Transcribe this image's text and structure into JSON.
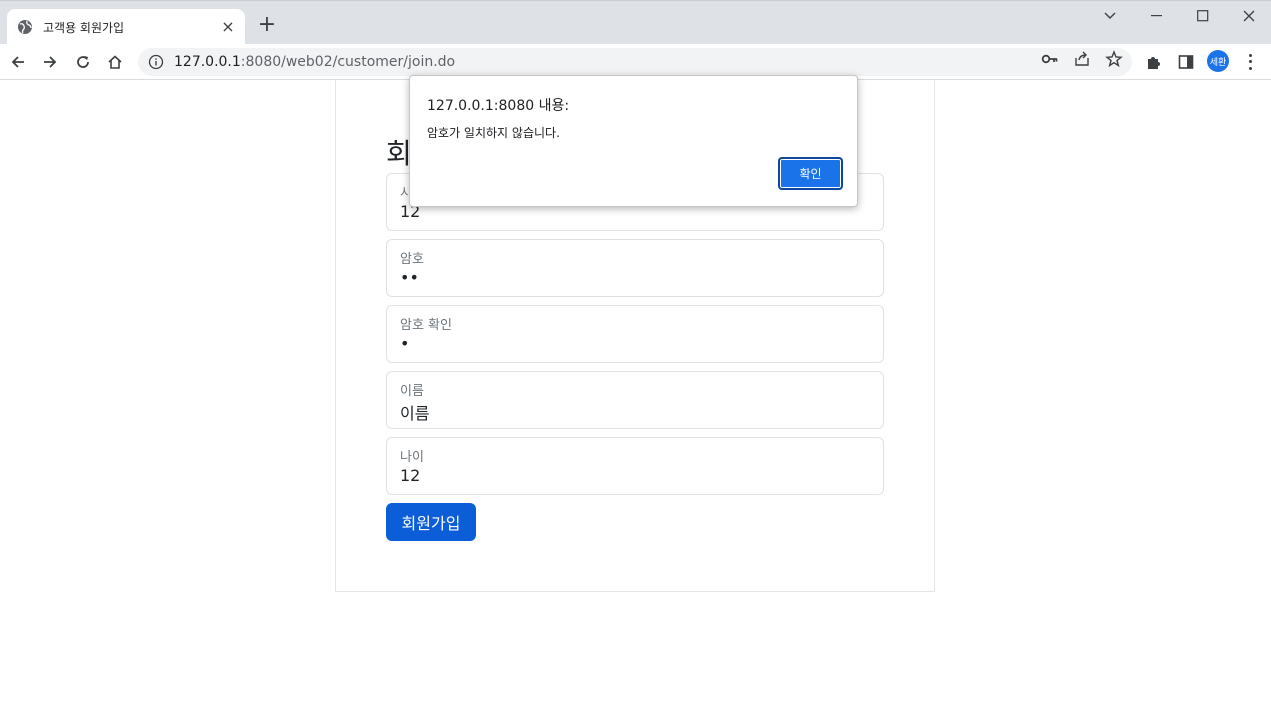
{
  "browser": {
    "tab_title": "고객용 회원가입",
    "url_host": "127.0.0.1",
    "url_path": ":8080/web02/customer/join.do",
    "profile_initials": "세환"
  },
  "page": {
    "heading": "회",
    "fields": [
      {
        "label": "시",
        "value": "12"
      },
      {
        "label": "암호",
        "value": "••"
      },
      {
        "label": "암호 확인",
        "value": "•"
      },
      {
        "label": "이름",
        "value": "이름"
      },
      {
        "label": "나이",
        "value": "12"
      }
    ],
    "submit_label": "회원가입"
  },
  "dialog": {
    "title": "127.0.0.1:8080 내용:",
    "message": "암호가 일치하지 않습니다.",
    "ok_label": "확인"
  },
  "colors": {
    "primary_button": "#0b5ed7",
    "dialog_button": "#1a73e8"
  }
}
